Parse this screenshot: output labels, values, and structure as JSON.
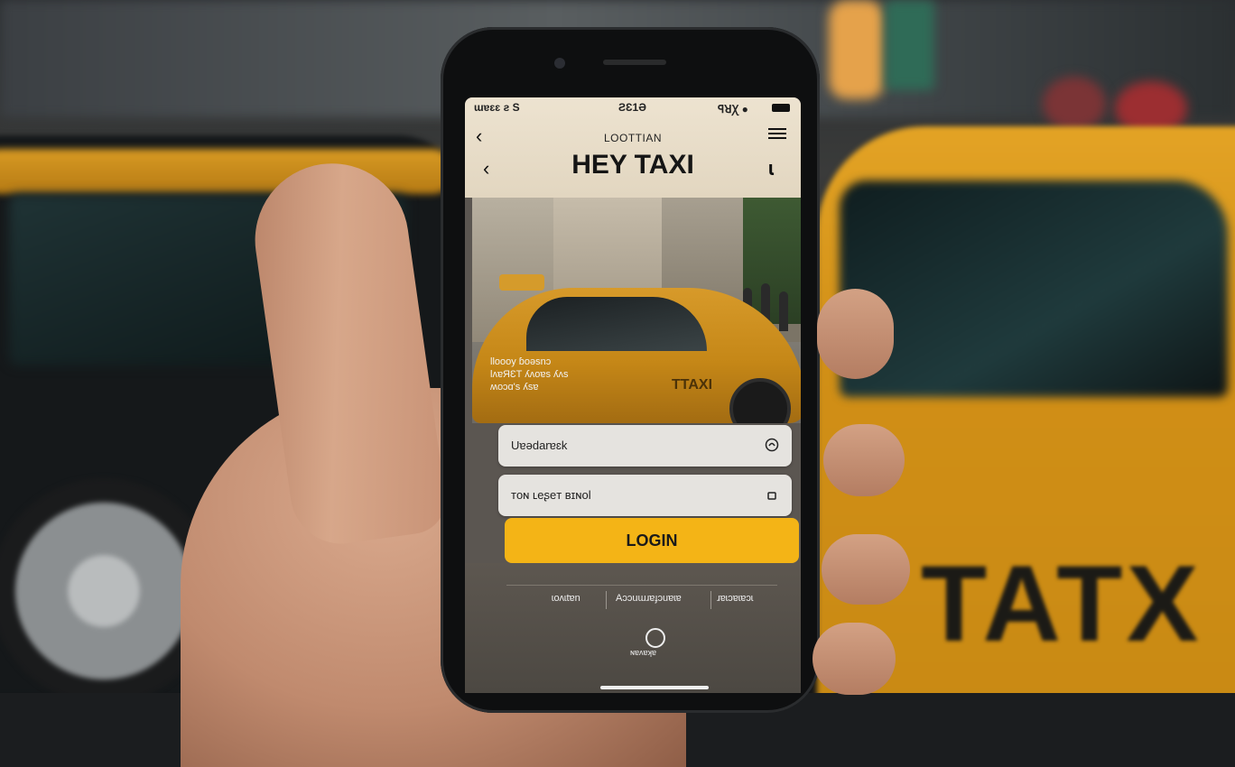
{
  "status_bar": {
    "left": "ɯɐɛɛ ƨ S",
    "center": "ƧƐ1Ə",
    "right": "ꟼꓤꞳ ●"
  },
  "header": {
    "subtitle": "LOOTTIAN",
    "title": "HEY TAXI",
    "back_glyph": "‹",
    "back_glyph_2": "‹",
    "right_glyph": "ɩ"
  },
  "photo": {
    "overlay_lines": [
      "lloooy ɓoəsnɔ",
      "lʌɐЯƐT ʎʌoɐs ʎʌs",
      "ʍoɔɑ's ʎsɐ"
    ],
    "taxi_label": "TTAXI"
  },
  "form": {
    "username_value": "Uɐədarɐɛk",
    "password_value": "ᴛoɴ ʟeʂeт ʙɪɴol",
    "login_label": "LOGIN"
  },
  "links": {
    "left": "ɩoʌɩtɐn",
    "center": "Aɔɔuɯɹɐɟɔuɐɩɐ",
    "right": "ɹɐɩɔɐɩɐɔɩ"
  },
  "bottom": {
    "label": "ɴɐʌɐʞɐ",
    "icon": "account-circle-icon"
  },
  "colors": {
    "accent": "#f4b416",
    "header_bg": "#e9dfcb"
  }
}
